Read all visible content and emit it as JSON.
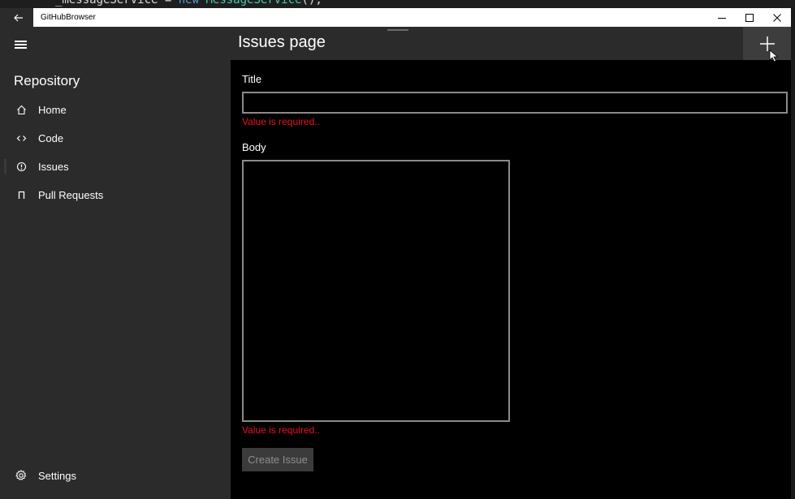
{
  "background_editor": {
    "code_field": "_messageService",
    "code_op": " = ",
    "code_keyword": "new",
    "code_type": " MessageService",
    "code_tail": "();"
  },
  "window": {
    "title": "GitHubBrowser",
    "back_icon": "back-arrow-icon",
    "controls": [
      "minimize-icon",
      "maximize-icon",
      "close-icon"
    ]
  },
  "nav": {
    "header": "Repository",
    "items": [
      {
        "label": "Home",
        "icon": "home-icon"
      },
      {
        "label": "Code",
        "icon": "code-icon"
      },
      {
        "label": "Issues",
        "icon": "issues-icon",
        "selected": true
      },
      {
        "label": "Pull Requests",
        "icon": "pull-request-icon"
      }
    ],
    "settings_label": "Settings"
  },
  "page": {
    "title": "Issues page",
    "add_icon": "plus-icon"
  },
  "form": {
    "title_label": "Title",
    "title_value": "",
    "title_error": "Value is required..",
    "body_label": "Body",
    "body_value": "",
    "body_error": "Value is required..",
    "submit_label": "Create Issue"
  },
  "colors": {
    "error": "#e81123",
    "nav_background": "#2b2b2b",
    "content_background": "#000000"
  }
}
